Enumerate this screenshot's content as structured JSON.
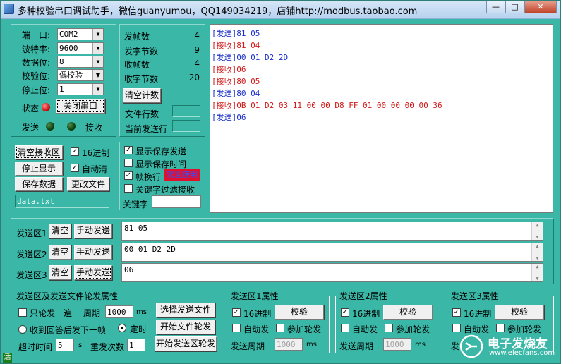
{
  "window": {
    "title": "多种校验串口调试助手，微信guanyumou，QQ149034219，店铺http://modbus.taobao.com",
    "minimize": "—",
    "maximize": "□",
    "close": "✕"
  },
  "port": {
    "port_label": "端　口:",
    "port_value": "COM2",
    "baud_label": "波特率:",
    "baud_value": "9600",
    "data_label": "数据位:",
    "data_value": "8",
    "parity_label": "校验位:",
    "parity_value": "偶校验",
    "stop_label": "停止位:",
    "stop_value": "1",
    "status_label": "状态",
    "close_btn": "关闭串口",
    "send_label": "发送",
    "recv_label": "接收",
    "colors": {
      "status": "#e02020",
      "led": "#0a4d0a"
    }
  },
  "stats": {
    "frames_sent_label": "发帧数",
    "frames_sent": "4",
    "bytes_sent_label": "发字节数",
    "bytes_sent": "9",
    "frames_recv_label": "收帧数",
    "frames_recv": "4",
    "bytes_recv_label": "收字节数",
    "bytes_recv": "20",
    "clear_btn": "清空计数",
    "file_lines_label": "文件行数",
    "current_line_label": "当前发送行"
  },
  "recv_ctrl": {
    "clear_btn": "清空接收区",
    "hex_label": "16进制",
    "hex_checked": true,
    "stop_btn": "停止显示",
    "autoclear_label": "自动清",
    "autoclear_checked": true,
    "save_btn": "保存数据",
    "change_file_btn": "更改文件",
    "filename": "data.txt"
  },
  "display": {
    "show_save_send": "显示保存发送",
    "show_save_send_checked": true,
    "show_save_time": "显示保存时间",
    "show_save_time_checked": false,
    "frame_newline": "帧换行",
    "frame_newline_checked": true,
    "badge": "欢迎使用",
    "keyword_filter": "关键字过滤接收",
    "keyword_filter_checked": false,
    "keyword_label": "关键字"
  },
  "recv_lines": [
    {
      "tag": "[发送]",
      "text": "81 05",
      "kind": "send"
    },
    {
      "tag": "[接收]",
      "text": "81 04",
      "kind": "recv"
    },
    {
      "tag": "[发送]",
      "text": "00 01 D2 2D",
      "kind": "send"
    },
    {
      "tag": "[接收]",
      "text": "06",
      "kind": "recv"
    },
    {
      "tag": "[接收]",
      "text": "80 05",
      "kind": "recv"
    },
    {
      "tag": "[发送]",
      "text": "80 04",
      "kind": "send"
    },
    {
      "tag": "[接收]",
      "text": "0B 01 D2 03 11 00 00 D8 FF 01 00 00 00 00 36",
      "kind": "recv"
    },
    {
      "tag": "[发送]",
      "text": "06",
      "kind": "send"
    }
  ],
  "send_areas": [
    {
      "label": "发送区1",
      "clear": "清空",
      "manual": "手动发送",
      "content": "81 05"
    },
    {
      "label": "发送区2",
      "clear": "清空",
      "manual": "手动发送",
      "content": "00 01 D2 2D"
    },
    {
      "label": "发送区3",
      "clear": "清空",
      "manual": "手动发送",
      "content": "06"
    }
  ],
  "rotation": {
    "title": "发送区及发送文件轮发属性",
    "once_label": "只轮发一遍",
    "period_label": "周期",
    "period_value": "1000",
    "ms": "ms",
    "select_file_btn": "选择发送文件",
    "after_reply_label": "收到回答后发下一帧",
    "timed_label": "定时",
    "start_file_btn": "开始文件轮发",
    "timeout_label": "超时时间",
    "timeout_value": "5",
    "s": "s",
    "resend_label": "重发次数",
    "resend_value": "1",
    "start_area_btn": "开始发送区轮发"
  },
  "area_props": [
    {
      "title": "发送区1属性",
      "hex": "16进制",
      "check_btn": "校验",
      "auto": "自动发",
      "join": "参加轮发",
      "period_label": "发送周期",
      "period": "1000",
      "ms": "ms"
    },
    {
      "title": "发送区2属性",
      "hex": "16进制",
      "check_btn": "校验",
      "auto": "自动发",
      "join": "参加轮发",
      "period_label": "发送周期",
      "period": "1000",
      "ms": "ms"
    },
    {
      "title": "发送区3属性",
      "hex": "16进制",
      "check_btn": "校验",
      "auto": "自动发",
      "join": "参加轮发",
      "period_label": "发",
      "period": "",
      "ms": ""
    }
  ],
  "watermark": {
    "text": "电子发烧友",
    "sub": "www.elecfans.com"
  },
  "corner_glyph": "活"
}
